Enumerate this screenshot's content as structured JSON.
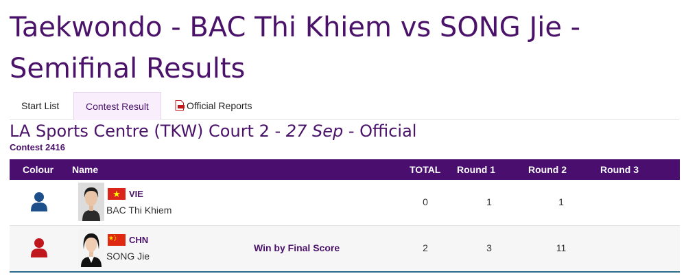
{
  "page": {
    "title": "Taekwondo - BAC Thi Khiem vs SONG Jie - Semifinal Results"
  },
  "tabs": [
    {
      "label": "Start List",
      "active": false
    },
    {
      "label": "Contest Result",
      "active": true
    },
    {
      "label": "Official Reports",
      "active": false,
      "icon": "pdf-icon"
    }
  ],
  "venue": {
    "prefix": "LA Sports Centre (TKW) Court 2 - ",
    "date": "27 Sep",
    "suffix": " - Official"
  },
  "contest": "Contest 2416",
  "table": {
    "headers": {
      "colour": "Colour",
      "name": "Name",
      "total": "TOTAL",
      "round1": "Round 1",
      "round2": "Round 2",
      "round3": "Round 3"
    },
    "rows": [
      {
        "colour": "blue",
        "colour_hex": "#1d4f8a",
        "noc": "VIE",
        "name": "BAC Thi Khiem",
        "status": "",
        "total": "0",
        "round1": "1",
        "round2": "1",
        "round3": ""
      },
      {
        "colour": "red",
        "colour_hex": "#c0171d",
        "noc": "CHN",
        "name": "SONG Jie",
        "status": "Win by Final Score",
        "total": "2",
        "round1": "3",
        "round2": "11",
        "round3": ""
      }
    ]
  },
  "colors": {
    "brand": "#4a1269",
    "header_bg": "#4a0e6e",
    "tab_active_bg": "#f8eefc"
  }
}
